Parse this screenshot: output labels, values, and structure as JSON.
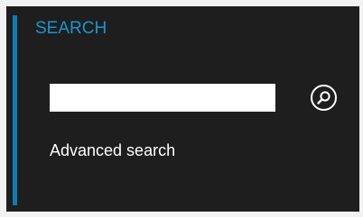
{
  "search_panel": {
    "title": "SEARCH",
    "input_value": "",
    "search_button_icon": "search-icon",
    "advanced_link_label": "Advanced search",
    "accent_color": "#0e7cb4",
    "title_color": "#1996cf",
    "background_color": "#1e1e1e"
  }
}
